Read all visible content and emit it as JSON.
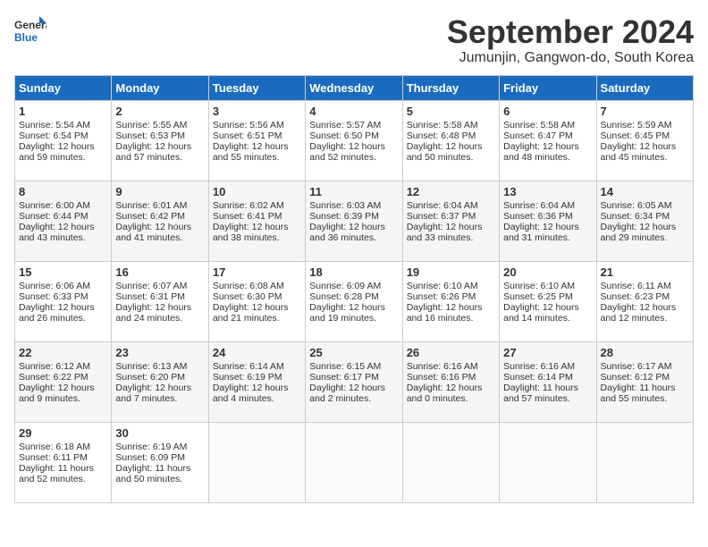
{
  "logo": {
    "line1": "General",
    "line2": "Blue"
  },
  "title": "September 2024",
  "location": "Jumunjin, Gangwon-do, South Korea",
  "days_of_week": [
    "Sunday",
    "Monday",
    "Tuesday",
    "Wednesday",
    "Thursday",
    "Friday",
    "Saturday"
  ],
  "weeks": [
    [
      {
        "day": "1",
        "sunrise": "5:54 AM",
        "sunset": "6:54 PM",
        "daylight": "12 hours and 59 minutes."
      },
      {
        "day": "2",
        "sunrise": "5:55 AM",
        "sunset": "6:53 PM",
        "daylight": "12 hours and 57 minutes."
      },
      {
        "day": "3",
        "sunrise": "5:56 AM",
        "sunset": "6:51 PM",
        "daylight": "12 hours and 55 minutes."
      },
      {
        "day": "4",
        "sunrise": "5:57 AM",
        "sunset": "6:50 PM",
        "daylight": "12 hours and 52 minutes."
      },
      {
        "day": "5",
        "sunrise": "5:58 AM",
        "sunset": "6:48 PM",
        "daylight": "12 hours and 50 minutes."
      },
      {
        "day": "6",
        "sunrise": "5:58 AM",
        "sunset": "6:47 PM",
        "daylight": "12 hours and 48 minutes."
      },
      {
        "day": "7",
        "sunrise": "5:59 AM",
        "sunset": "6:45 PM",
        "daylight": "12 hours and 45 minutes."
      }
    ],
    [
      {
        "day": "8",
        "sunrise": "6:00 AM",
        "sunset": "6:44 PM",
        "daylight": "12 hours and 43 minutes."
      },
      {
        "day": "9",
        "sunrise": "6:01 AM",
        "sunset": "6:42 PM",
        "daylight": "12 hours and 41 minutes."
      },
      {
        "day": "10",
        "sunrise": "6:02 AM",
        "sunset": "6:41 PM",
        "daylight": "12 hours and 38 minutes."
      },
      {
        "day": "11",
        "sunrise": "6:03 AM",
        "sunset": "6:39 PM",
        "daylight": "12 hours and 36 minutes."
      },
      {
        "day": "12",
        "sunrise": "6:04 AM",
        "sunset": "6:37 PM",
        "daylight": "12 hours and 33 minutes."
      },
      {
        "day": "13",
        "sunrise": "6:04 AM",
        "sunset": "6:36 PM",
        "daylight": "12 hours and 31 minutes."
      },
      {
        "day": "14",
        "sunrise": "6:05 AM",
        "sunset": "6:34 PM",
        "daylight": "12 hours and 29 minutes."
      }
    ],
    [
      {
        "day": "15",
        "sunrise": "6:06 AM",
        "sunset": "6:33 PM",
        "daylight": "12 hours and 26 minutes."
      },
      {
        "day": "16",
        "sunrise": "6:07 AM",
        "sunset": "6:31 PM",
        "daylight": "12 hours and 24 minutes."
      },
      {
        "day": "17",
        "sunrise": "6:08 AM",
        "sunset": "6:30 PM",
        "daylight": "12 hours and 21 minutes."
      },
      {
        "day": "18",
        "sunrise": "6:09 AM",
        "sunset": "6:28 PM",
        "daylight": "12 hours and 19 minutes."
      },
      {
        "day": "19",
        "sunrise": "6:10 AM",
        "sunset": "6:26 PM",
        "daylight": "12 hours and 16 minutes."
      },
      {
        "day": "20",
        "sunrise": "6:10 AM",
        "sunset": "6:25 PM",
        "daylight": "12 hours and 14 minutes."
      },
      {
        "day": "21",
        "sunrise": "6:11 AM",
        "sunset": "6:23 PM",
        "daylight": "12 hours and 12 minutes."
      }
    ],
    [
      {
        "day": "22",
        "sunrise": "6:12 AM",
        "sunset": "6:22 PM",
        "daylight": "12 hours and 9 minutes."
      },
      {
        "day": "23",
        "sunrise": "6:13 AM",
        "sunset": "6:20 PM",
        "daylight": "12 hours and 7 minutes."
      },
      {
        "day": "24",
        "sunrise": "6:14 AM",
        "sunset": "6:19 PM",
        "daylight": "12 hours and 4 minutes."
      },
      {
        "day": "25",
        "sunrise": "6:15 AM",
        "sunset": "6:17 PM",
        "daylight": "12 hours and 2 minutes."
      },
      {
        "day": "26",
        "sunrise": "6:16 AM",
        "sunset": "6:16 PM",
        "daylight": "12 hours and 0 minutes."
      },
      {
        "day": "27",
        "sunrise": "6:16 AM",
        "sunset": "6:14 PM",
        "daylight": "11 hours and 57 minutes."
      },
      {
        "day": "28",
        "sunrise": "6:17 AM",
        "sunset": "6:12 PM",
        "daylight": "11 hours and 55 minutes."
      }
    ],
    [
      {
        "day": "29",
        "sunrise": "6:18 AM",
        "sunset": "6:11 PM",
        "daylight": "11 hours and 52 minutes."
      },
      {
        "day": "30",
        "sunrise": "6:19 AM",
        "sunset": "6:09 PM",
        "daylight": "11 hours and 50 minutes."
      },
      null,
      null,
      null,
      null,
      null
    ]
  ]
}
